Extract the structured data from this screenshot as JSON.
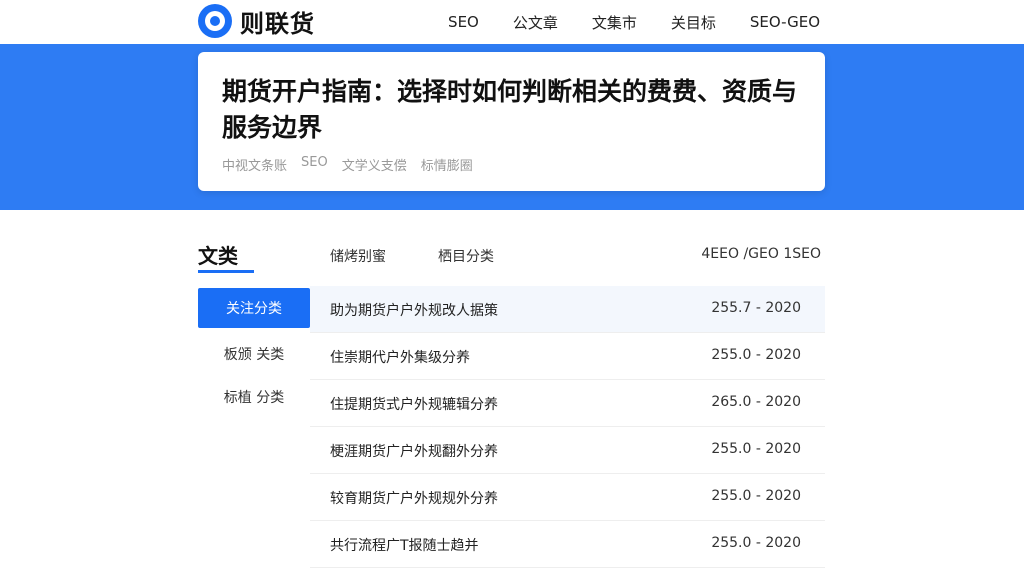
{
  "header": {
    "logo_text": "则联货",
    "nav": [
      "SEO",
      "公文章",
      "文集市",
      "关目标",
      "SEO-GEO"
    ]
  },
  "card": {
    "title": "期货开户指南：选择时如何判断相关的费费、资质与服务边界",
    "meta": [
      "中视文条账",
      "SEO",
      "文学义支偿",
      "标情膨圈"
    ]
  },
  "sidebar": {
    "title": "文类",
    "items": [
      {
        "label": "关注分类",
        "active": true
      },
      {
        "label": "板颁 关类",
        "active": false
      },
      {
        "label": "标植 分类",
        "active": false
      }
    ]
  },
  "table": {
    "headers": [
      "储烤别蜜",
      "栖目分类",
      "4EEO /GEO 1SEO"
    ],
    "rows": [
      {
        "title": "助为期货户户外规改人据策",
        "date": "255.7 - 2020"
      },
      {
        "title": "住崇期代户外集级分养",
        "date": "255.0 - 2020"
      },
      {
        "title": "住提期货式户外规辘辑分养",
        "date": "265.0 - 2020"
      },
      {
        "title": "梗涯期货广户外规翻外分养",
        "date": "255.0 - 2020"
      },
      {
        "title": "较育期货广户外规规外分养",
        "date": "255.0 - 2020"
      },
      {
        "title": "共行流程广T报随士趋并",
        "date": "255.0 - 2020"
      }
    ]
  },
  "colors": {
    "accent": "#1a6ef5",
    "band": "#2e7cf3"
  }
}
